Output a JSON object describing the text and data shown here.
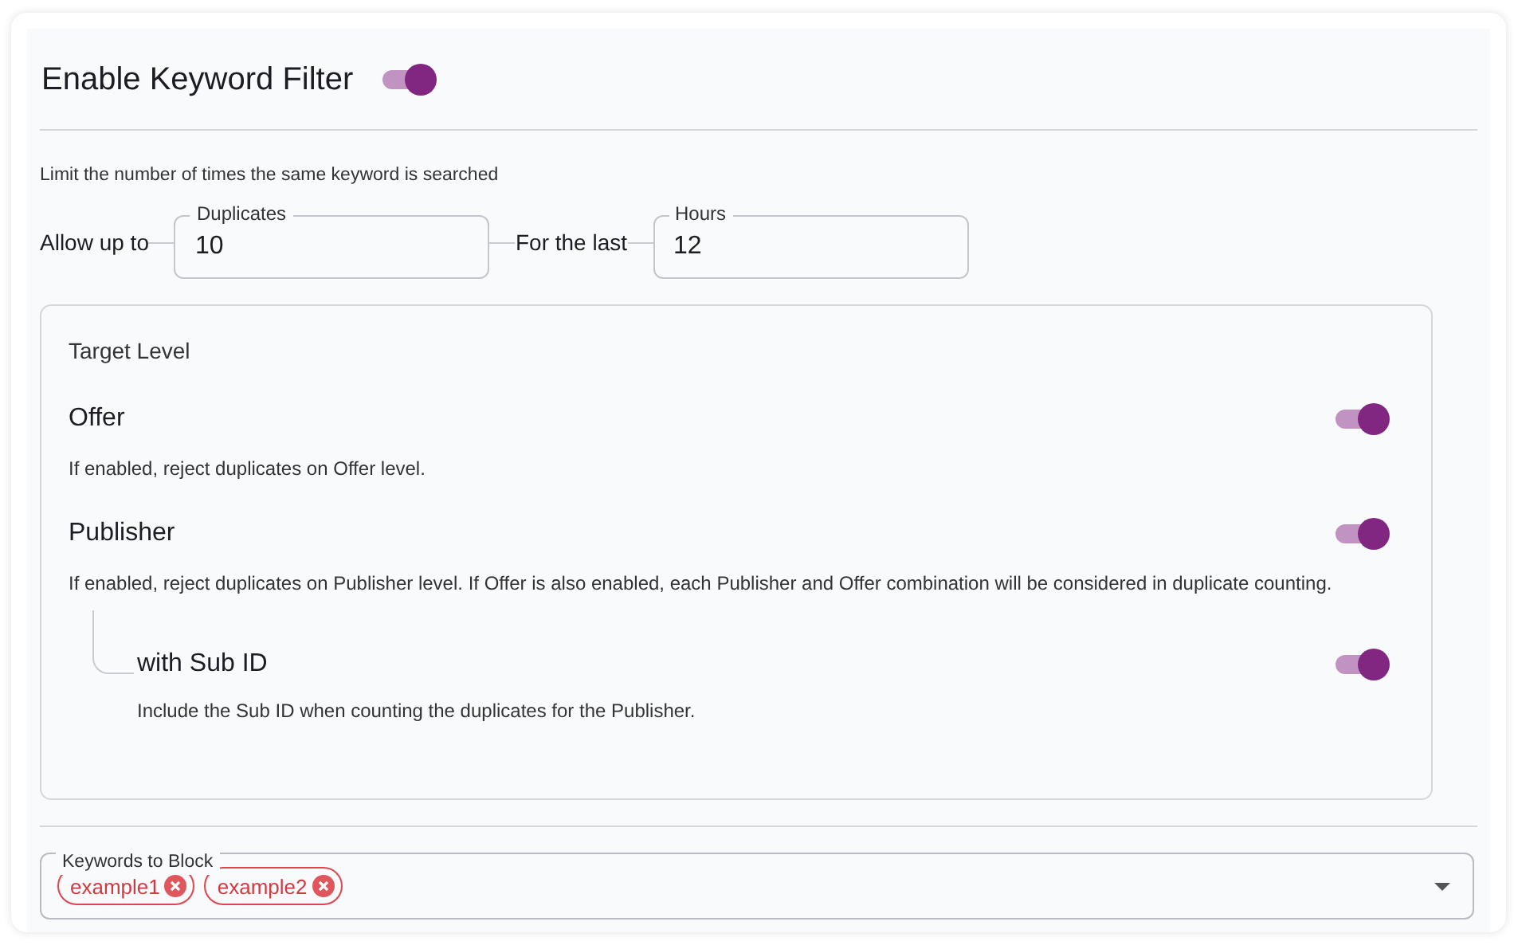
{
  "header": {
    "title": "Enable Keyword Filter",
    "on": true
  },
  "description": "Limit the number of times the same keyword is searched",
  "limit_row": [
    {
      "kind": "text",
      "text": "Allow up to"
    },
    {
      "kind": "field",
      "label": "Duplicates",
      "value": "10"
    },
    {
      "kind": "text",
      "text": "For the last"
    },
    {
      "kind": "field",
      "label": "Hours",
      "value": "12"
    }
  ],
  "target_level": {
    "title": "Target Level",
    "options": [
      {
        "label": "Offer",
        "description": "If enabled, reject duplicates on Offer level.",
        "on": true
      },
      {
        "label": "Publisher",
        "description": "If enabled, reject duplicates on Publisher level. If Offer is also enabled, each Publisher and Offer combination will be considered in duplicate counting.",
        "on": true,
        "children": [
          {
            "label": "with Sub ID",
            "description": "Include the Sub ID when counting the duplicates for the Publisher.",
            "on": true
          }
        ]
      }
    ]
  },
  "keywords": {
    "label": "Keywords to Block",
    "tags": [
      {
        "text": "example1"
      },
      {
        "text": "example2"
      }
    ]
  }
}
